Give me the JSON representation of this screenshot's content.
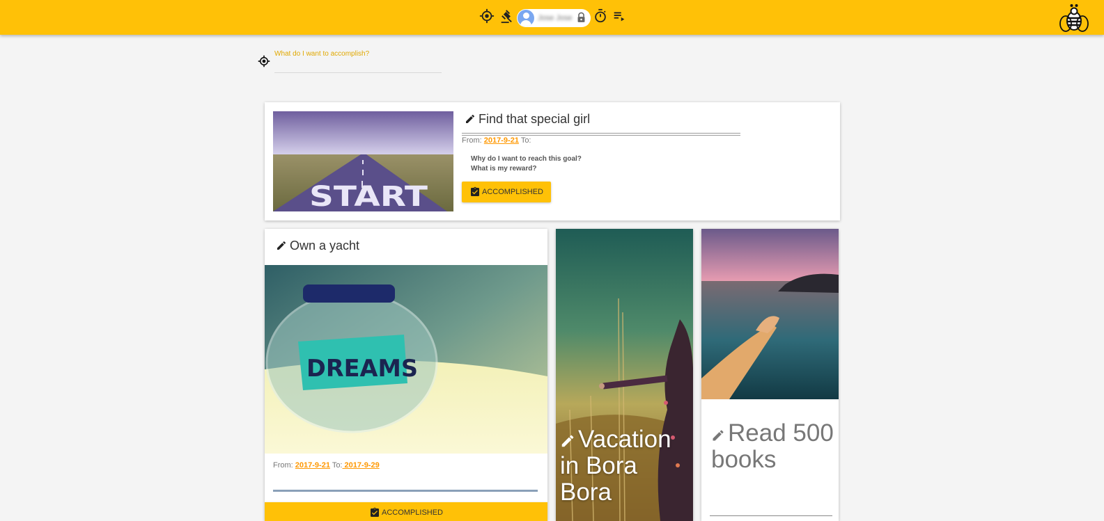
{
  "topbar": {
    "icons": [
      "target-icon",
      "gavel-icon",
      "account-icon",
      "lock-icon",
      "timer-icon",
      "playlist-icon",
      "bee-logo"
    ],
    "user_name": "Jose Jose",
    "accent": "#ffc107"
  },
  "goal_input": {
    "label": "What do I want to accomplish?",
    "value": ""
  },
  "goals": [
    {
      "title": "Find that special girl",
      "from_label": "From:",
      "from": "2017-9-21",
      "to_label": "To:",
      "to": "",
      "why": "Why do I want to reach this goal?",
      "reward": "What is my reward?",
      "button": "ACCOMPLISHED",
      "image": "road-start-image"
    },
    {
      "title": "Own a yacht",
      "from_label": "From:",
      "from": "2017-9-21",
      "to_label": "To:",
      "to": " 2017-9-29",
      "button": "ACCOMPLISHED",
      "image": "dreams-jar-image"
    },
    {
      "title": "Vacation in Bora Bora",
      "image": "field-woman-image"
    },
    {
      "title": "Read 500 books",
      "image": "sea-hand-image"
    }
  ],
  "colors": {
    "link": "#ff9800",
    "button": "#ffc107",
    "background": "#f4f4f4"
  }
}
